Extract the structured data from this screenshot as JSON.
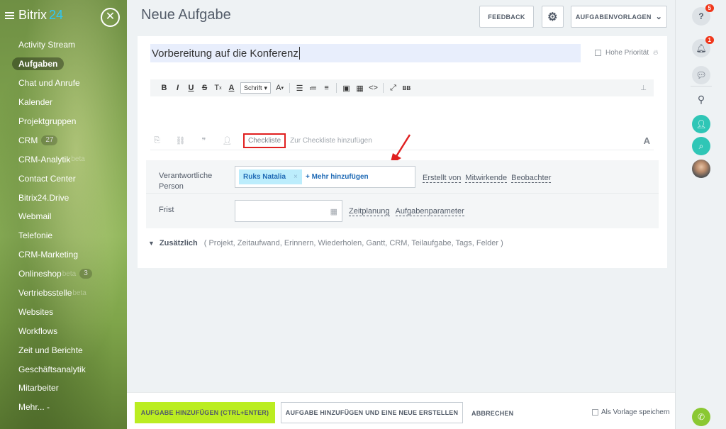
{
  "sidebar": {
    "brand": "Bitrix",
    "brand_num": "24",
    "items": [
      {
        "label": "Activity Stream"
      },
      {
        "label": "Aufgaben",
        "active": true
      },
      {
        "label": "Chat und Anrufe"
      },
      {
        "label": "Kalender"
      },
      {
        "label": "Projektgruppen"
      },
      {
        "label": "CRM",
        "count": "27"
      },
      {
        "label": "CRM-Analytik",
        "beta": "beta"
      },
      {
        "label": "Contact Center"
      },
      {
        "label": "Bitrix24.Drive"
      },
      {
        "label": "Webmail"
      },
      {
        "label": "Telefonie"
      },
      {
        "label": "CRM-Marketing"
      },
      {
        "label": "Onlineshop",
        "beta": "beta",
        "count": "3"
      },
      {
        "label": "Vertriebsstelle",
        "beta": "beta"
      },
      {
        "label": "Websites"
      },
      {
        "label": "Workflows"
      },
      {
        "label": "Zeit und Berichte"
      },
      {
        "label": "Geschäftsanalytik"
      },
      {
        "label": "Mitarbeiter"
      },
      {
        "label": "Mehr... -"
      }
    ]
  },
  "header": {
    "title": "Neue Aufgabe",
    "feedback_label": "FEEDBACK",
    "templates_label": "AUFGABENVORLAGEN"
  },
  "task": {
    "title_value": "Vorbereitung auf die Konferenz",
    "high_priority_label": "Hohe Priorität",
    "font_select": "Schrift",
    "checklist_button": "Checkliste",
    "checklist_hint": "Zur Checkliste hinzufügen",
    "responsible_label": "Verantwortliche Person",
    "responsible_person": "Ruks Natalia",
    "add_more": "+ Mehr hinzufügen",
    "role_links": [
      "Erstellt von",
      "Mitwirkende",
      "Beobachter"
    ],
    "deadline_label": "Frist",
    "date_links": [
      "Zeitplanung",
      "Aufgabenparameter"
    ],
    "additional_label": "Zusätzlich",
    "additional_items": "( Projekt,  Zeitaufwand,  Erinnern,  Wiederholen,  Gantt,  CRM,  Teilaufgabe,  Tags,  Felder )"
  },
  "footer": {
    "add_label": "AUFGABE HINZUFÜGEN (CTRL+ENTER)",
    "add_new_label": "AUFGABE HINZUFÜGEN UND EINE NEUE ERSTELLEN",
    "cancel_label": "ABBRECHEN",
    "save_template_label": "Als Vorlage speichern"
  },
  "right_panel": {
    "help_badge": "5",
    "bell_badge": "1"
  },
  "colors": {
    "accent_green": "#bbed21",
    "link_blue": "#1f6ab5",
    "highlight_red": "#e02020",
    "brand_blue": "#2fc6f6"
  }
}
